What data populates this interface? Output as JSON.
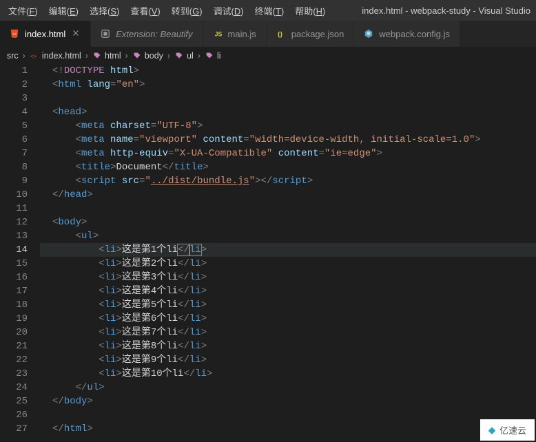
{
  "menubar": {
    "items": [
      {
        "label": "文件",
        "hotkey": "F"
      },
      {
        "label": "编辑",
        "hotkey": "E"
      },
      {
        "label": "选择",
        "hotkey": "S"
      },
      {
        "label": "查看",
        "hotkey": "V"
      },
      {
        "label": "转到",
        "hotkey": "G"
      },
      {
        "label": "调试",
        "hotkey": "D"
      },
      {
        "label": "终端",
        "hotkey": "T"
      },
      {
        "label": "帮助",
        "hotkey": "H"
      }
    ],
    "title": "index.html - webpack-study - Visual Studio"
  },
  "tabs": [
    {
      "icon": "html",
      "label": "index.html",
      "active": true,
      "italic": false,
      "close": true,
      "icon_color": "#e44d26"
    },
    {
      "icon": "ext",
      "label": "Extension: Beautify",
      "active": false,
      "italic": true,
      "close": false,
      "icon_color": "#999"
    },
    {
      "icon": "js",
      "label": "main.js",
      "active": false,
      "italic": false,
      "close": false,
      "icon_color": "#cbcb41"
    },
    {
      "icon": "json",
      "label": "package.json",
      "active": false,
      "italic": false,
      "close": false,
      "icon_color": "#cbcb41"
    },
    {
      "icon": "webpack",
      "label": "webpack.config.js",
      "active": false,
      "italic": false,
      "close": false,
      "icon_color": "#519aba"
    }
  ],
  "breadcrumbs": {
    "parts": [
      {
        "icon": null,
        "label": "src",
        "color": "#999"
      },
      {
        "icon": "html-file",
        "label": "index.html",
        "color": "#e44d26"
      },
      {
        "icon": "tag",
        "label": "html",
        "color": "#c586c0"
      },
      {
        "icon": "tag",
        "label": "body",
        "color": "#c586c0"
      },
      {
        "icon": "tag",
        "label": "ul",
        "color": "#c586c0"
      },
      {
        "icon": "tag",
        "label": "li",
        "color": "#c586c0"
      }
    ],
    "sep": "›"
  },
  "editor": {
    "active_line": 14,
    "lines": [
      {
        "n": 1,
        "segs": [
          {
            "t": "<!",
            "c": "punct"
          },
          {
            "t": "DOCTYPE ",
            "c": "meta-kw"
          },
          {
            "t": "html",
            "c": "attr-name"
          },
          {
            "t": ">",
            "c": "punct"
          }
        ],
        "indent": 0
      },
      {
        "n": 2,
        "segs": [
          {
            "t": "<",
            "c": "punct"
          },
          {
            "t": "html ",
            "c": "tag"
          },
          {
            "t": "lang",
            "c": "attr-name"
          },
          {
            "t": "=",
            "c": "punct"
          },
          {
            "t": "\"en\"",
            "c": "attr-val"
          },
          {
            "t": ">",
            "c": "punct"
          }
        ],
        "indent": 0
      },
      {
        "n": 3,
        "segs": [],
        "indent": 0
      },
      {
        "n": 4,
        "segs": [
          {
            "t": "<",
            "c": "punct"
          },
          {
            "t": "head",
            "c": "tag"
          },
          {
            "t": ">",
            "c": "punct"
          }
        ],
        "indent": 0
      },
      {
        "n": 5,
        "segs": [
          {
            "t": "<",
            "c": "punct"
          },
          {
            "t": "meta ",
            "c": "tag"
          },
          {
            "t": "charset",
            "c": "attr-name"
          },
          {
            "t": "=",
            "c": "punct"
          },
          {
            "t": "\"UTF-8\"",
            "c": "attr-val"
          },
          {
            "t": ">",
            "c": "punct"
          }
        ],
        "indent": 1
      },
      {
        "n": 6,
        "segs": [
          {
            "t": "<",
            "c": "punct"
          },
          {
            "t": "meta ",
            "c": "tag"
          },
          {
            "t": "name",
            "c": "attr-name"
          },
          {
            "t": "=",
            "c": "punct"
          },
          {
            "t": "\"viewport\" ",
            "c": "attr-val"
          },
          {
            "t": "content",
            "c": "attr-name"
          },
          {
            "t": "=",
            "c": "punct"
          },
          {
            "t": "\"width=device-width, initial-scale=1.0\"",
            "c": "attr-val"
          },
          {
            "t": ">",
            "c": "punct"
          }
        ],
        "indent": 1
      },
      {
        "n": 7,
        "segs": [
          {
            "t": "<",
            "c": "punct"
          },
          {
            "t": "meta ",
            "c": "tag"
          },
          {
            "t": "http-equiv",
            "c": "attr-name"
          },
          {
            "t": "=",
            "c": "punct"
          },
          {
            "t": "\"X-UA-Compatible\" ",
            "c": "attr-val"
          },
          {
            "t": "content",
            "c": "attr-name"
          },
          {
            "t": "=",
            "c": "punct"
          },
          {
            "t": "\"ie=edge\"",
            "c": "attr-val"
          },
          {
            "t": ">",
            "c": "punct"
          }
        ],
        "indent": 1
      },
      {
        "n": 8,
        "segs": [
          {
            "t": "<",
            "c": "punct"
          },
          {
            "t": "title",
            "c": "tag"
          },
          {
            "t": ">",
            "c": "punct"
          },
          {
            "t": "Document",
            "c": "textc"
          },
          {
            "t": "</",
            "c": "punct"
          },
          {
            "t": "title",
            "c": "tag"
          },
          {
            "t": ">",
            "c": "punct"
          }
        ],
        "indent": 1
      },
      {
        "n": 9,
        "segs": [
          {
            "t": "<",
            "c": "punct"
          },
          {
            "t": "script ",
            "c": "tag"
          },
          {
            "t": "src",
            "c": "attr-name"
          },
          {
            "t": "=",
            "c": "punct"
          },
          {
            "t": "\"",
            "c": "attr-val"
          },
          {
            "t": "../dist/bundle.js",
            "c": "attr-val underline"
          },
          {
            "t": "\"",
            "c": "attr-val"
          },
          {
            "t": "></",
            "c": "punct"
          },
          {
            "t": "script",
            "c": "tag"
          },
          {
            "t": ">",
            "c": "punct"
          }
        ],
        "indent": 1
      },
      {
        "n": 10,
        "segs": [
          {
            "t": "</",
            "c": "punct"
          },
          {
            "t": "head",
            "c": "tag"
          },
          {
            "t": ">",
            "c": "punct"
          }
        ],
        "indent": 0
      },
      {
        "n": 11,
        "segs": [],
        "indent": 0
      },
      {
        "n": 12,
        "segs": [
          {
            "t": "<",
            "c": "punct"
          },
          {
            "t": "body",
            "c": "tag"
          },
          {
            "t": ">",
            "c": "punct"
          }
        ],
        "indent": 0
      },
      {
        "n": 13,
        "segs": [
          {
            "t": "<",
            "c": "punct"
          },
          {
            "t": "ul",
            "c": "tag"
          },
          {
            "t": ">",
            "c": "punct"
          }
        ],
        "indent": 1
      },
      {
        "n": 14,
        "segs": [
          {
            "t": "<",
            "c": "punct"
          },
          {
            "t": "li",
            "c": "tag"
          },
          {
            "t": ">",
            "c": "punct"
          },
          {
            "t": "这是第1个li",
            "c": "textc"
          },
          {
            "t": "</",
            "c": "punct cursor-box"
          },
          {
            "t": "li",
            "c": "tag cursor-box"
          },
          {
            "t": ">",
            "c": "punct"
          }
        ],
        "indent": 2,
        "active": true
      },
      {
        "n": 15,
        "segs": [
          {
            "t": "<",
            "c": "punct"
          },
          {
            "t": "li",
            "c": "tag"
          },
          {
            "t": ">",
            "c": "punct"
          },
          {
            "t": "这是第2个li",
            "c": "textc"
          },
          {
            "t": "</",
            "c": "punct"
          },
          {
            "t": "li",
            "c": "tag"
          },
          {
            "t": ">",
            "c": "punct"
          }
        ],
        "indent": 2
      },
      {
        "n": 16,
        "segs": [
          {
            "t": "<",
            "c": "punct"
          },
          {
            "t": "li",
            "c": "tag"
          },
          {
            "t": ">",
            "c": "punct"
          },
          {
            "t": "这是第3个li",
            "c": "textc"
          },
          {
            "t": "</",
            "c": "punct"
          },
          {
            "t": "li",
            "c": "tag"
          },
          {
            "t": ">",
            "c": "punct"
          }
        ],
        "indent": 2
      },
      {
        "n": 17,
        "segs": [
          {
            "t": "<",
            "c": "punct"
          },
          {
            "t": "li",
            "c": "tag"
          },
          {
            "t": ">",
            "c": "punct"
          },
          {
            "t": "这是第4个li",
            "c": "textc"
          },
          {
            "t": "</",
            "c": "punct"
          },
          {
            "t": "li",
            "c": "tag"
          },
          {
            "t": ">",
            "c": "punct"
          }
        ],
        "indent": 2
      },
      {
        "n": 18,
        "segs": [
          {
            "t": "<",
            "c": "punct"
          },
          {
            "t": "li",
            "c": "tag"
          },
          {
            "t": ">",
            "c": "punct"
          },
          {
            "t": "这是第5个li",
            "c": "textc"
          },
          {
            "t": "</",
            "c": "punct"
          },
          {
            "t": "li",
            "c": "tag"
          },
          {
            "t": ">",
            "c": "punct"
          }
        ],
        "indent": 2
      },
      {
        "n": 19,
        "segs": [
          {
            "t": "<",
            "c": "punct"
          },
          {
            "t": "li",
            "c": "tag"
          },
          {
            "t": ">",
            "c": "punct"
          },
          {
            "t": "这是第6个li",
            "c": "textc"
          },
          {
            "t": "</",
            "c": "punct"
          },
          {
            "t": "li",
            "c": "tag"
          },
          {
            "t": ">",
            "c": "punct"
          }
        ],
        "indent": 2
      },
      {
        "n": 20,
        "segs": [
          {
            "t": "<",
            "c": "punct"
          },
          {
            "t": "li",
            "c": "tag"
          },
          {
            "t": ">",
            "c": "punct"
          },
          {
            "t": "这是第7个li",
            "c": "textc"
          },
          {
            "t": "</",
            "c": "punct"
          },
          {
            "t": "li",
            "c": "tag"
          },
          {
            "t": ">",
            "c": "punct"
          }
        ],
        "indent": 2
      },
      {
        "n": 21,
        "segs": [
          {
            "t": "<",
            "c": "punct"
          },
          {
            "t": "li",
            "c": "tag"
          },
          {
            "t": ">",
            "c": "punct"
          },
          {
            "t": "这是第8个li",
            "c": "textc"
          },
          {
            "t": "</",
            "c": "punct"
          },
          {
            "t": "li",
            "c": "tag"
          },
          {
            "t": ">",
            "c": "punct"
          }
        ],
        "indent": 2
      },
      {
        "n": 22,
        "segs": [
          {
            "t": "<",
            "c": "punct"
          },
          {
            "t": "li",
            "c": "tag"
          },
          {
            "t": ">",
            "c": "punct"
          },
          {
            "t": "这是第9个li",
            "c": "textc"
          },
          {
            "t": "</",
            "c": "punct"
          },
          {
            "t": "li",
            "c": "tag"
          },
          {
            "t": ">",
            "c": "punct"
          }
        ],
        "indent": 2
      },
      {
        "n": 23,
        "segs": [
          {
            "t": "<",
            "c": "punct"
          },
          {
            "t": "li",
            "c": "tag"
          },
          {
            "t": ">",
            "c": "punct"
          },
          {
            "t": "这是第10个li",
            "c": "textc"
          },
          {
            "t": "</",
            "c": "punct"
          },
          {
            "t": "li",
            "c": "tag"
          },
          {
            "t": ">",
            "c": "punct"
          }
        ],
        "indent": 2
      },
      {
        "n": 24,
        "segs": [
          {
            "t": "</",
            "c": "punct"
          },
          {
            "t": "ul",
            "c": "tag"
          },
          {
            "t": ">",
            "c": "punct"
          }
        ],
        "indent": 1
      },
      {
        "n": 25,
        "segs": [
          {
            "t": "</",
            "c": "punct"
          },
          {
            "t": "body",
            "c": "tag"
          },
          {
            "t": ">",
            "c": "punct"
          }
        ],
        "indent": 0
      },
      {
        "n": 26,
        "segs": [],
        "indent": 0
      },
      {
        "n": 27,
        "segs": [
          {
            "t": "</",
            "c": "punct"
          },
          {
            "t": "html",
            "c": "tag"
          },
          {
            "t": ">",
            "c": "punct"
          }
        ],
        "indent": 0
      }
    ]
  },
  "watermark": {
    "text": "亿速云"
  }
}
